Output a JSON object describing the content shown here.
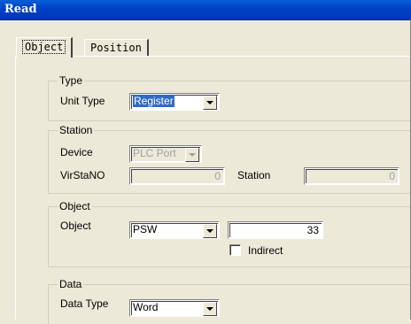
{
  "window": {
    "title": "Read"
  },
  "tabs": [
    {
      "label": "Object",
      "active": true
    },
    {
      "label": "Position",
      "active": false
    }
  ],
  "type_group": {
    "label": "Type",
    "unit_type_label": "Unit Type",
    "unit_type_value": "Register"
  },
  "station_group": {
    "label": "Station",
    "device_label": "Device",
    "device_value": "PLC Port",
    "virstano_label": "VirStaNO",
    "virstano_value": "0",
    "station_label": "Station",
    "station_value": "0"
  },
  "object_group": {
    "label": "Object",
    "object_label": "Object",
    "object_value": "PSW",
    "address_value": "33",
    "indirect_label": "Indirect",
    "indirect_checked": false
  },
  "data_group": {
    "label": "Data",
    "data_type_label": "Data Type",
    "data_type_value": "Word"
  },
  "icons": {
    "dropdown": "chevron-down-icon"
  }
}
